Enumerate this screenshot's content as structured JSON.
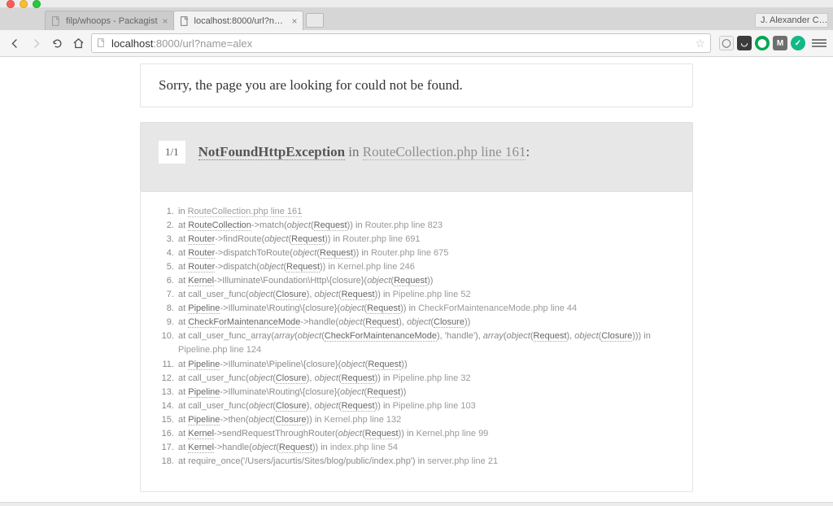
{
  "os": {
    "user_pill": "J. Alexander C…"
  },
  "tabs": [
    {
      "title": "filp/whoops - Packagist",
      "active": false
    },
    {
      "title": "localhost:8000/url?name=…",
      "active": true
    }
  ],
  "address": {
    "host": "localhost",
    "port_path": ":8000/url?name=alex"
  },
  "page": {
    "error_title": "Sorry, the page you are looking for could not be found.",
    "exception": {
      "counter": "1/1",
      "name": "NotFoundHttpException",
      "joiner": " in ",
      "file": "RouteCollection.php line 161",
      "colon": ":"
    },
    "trace": [
      [
        {
          "t": "plain",
          "v": "in "
        },
        {
          "t": "file-u",
          "v": "RouteCollection.php line 161"
        }
      ],
      [
        {
          "t": "at",
          "v": "at "
        },
        {
          "t": "class",
          "v": "RouteCollection"
        },
        {
          "t": "arrow",
          "v": "->"
        },
        {
          "t": "method",
          "v": "match("
        },
        {
          "t": "italic",
          "v": "object"
        },
        {
          "t": "plain",
          "v": "("
        },
        {
          "t": "obj",
          "v": "Request"
        },
        {
          "t": "plain",
          "v": ")) in "
        },
        {
          "t": "file",
          "v": "Router.php line 823"
        }
      ],
      [
        {
          "t": "at",
          "v": "at "
        },
        {
          "t": "class",
          "v": "Router"
        },
        {
          "t": "arrow",
          "v": "->"
        },
        {
          "t": "method",
          "v": "findRoute("
        },
        {
          "t": "italic",
          "v": "object"
        },
        {
          "t": "plain",
          "v": "("
        },
        {
          "t": "obj",
          "v": "Request"
        },
        {
          "t": "plain",
          "v": ")) in "
        },
        {
          "t": "file",
          "v": "Router.php line 691"
        }
      ],
      [
        {
          "t": "at",
          "v": "at "
        },
        {
          "t": "class",
          "v": "Router"
        },
        {
          "t": "arrow",
          "v": "->"
        },
        {
          "t": "method",
          "v": "dispatchToRoute("
        },
        {
          "t": "italic",
          "v": "object"
        },
        {
          "t": "plain",
          "v": "("
        },
        {
          "t": "obj",
          "v": "Request"
        },
        {
          "t": "plain",
          "v": ")) in "
        },
        {
          "t": "file",
          "v": "Router.php line 675"
        }
      ],
      [
        {
          "t": "at",
          "v": "at "
        },
        {
          "t": "class",
          "v": "Router"
        },
        {
          "t": "arrow",
          "v": "->"
        },
        {
          "t": "method",
          "v": "dispatch("
        },
        {
          "t": "italic",
          "v": "object"
        },
        {
          "t": "plain",
          "v": "("
        },
        {
          "t": "obj",
          "v": "Request"
        },
        {
          "t": "plain",
          "v": ")) in "
        },
        {
          "t": "file",
          "v": "Kernel.php line 246"
        }
      ],
      [
        {
          "t": "at",
          "v": "at "
        },
        {
          "t": "class",
          "v": "Kernel"
        },
        {
          "t": "arrow",
          "v": "->"
        },
        {
          "t": "method",
          "v": "Illuminate\\Foundation\\Http\\{closure}("
        },
        {
          "t": "italic",
          "v": "object"
        },
        {
          "t": "plain",
          "v": "("
        },
        {
          "t": "obj",
          "v": "Request"
        },
        {
          "t": "plain",
          "v": "))"
        }
      ],
      [
        {
          "t": "at",
          "v": "at "
        },
        {
          "t": "plain",
          "v": "call_user_func("
        },
        {
          "t": "italic",
          "v": "object"
        },
        {
          "t": "plain",
          "v": "("
        },
        {
          "t": "obj",
          "v": "Closure"
        },
        {
          "t": "plain",
          "v": "), "
        },
        {
          "t": "italic",
          "v": "object"
        },
        {
          "t": "plain",
          "v": "("
        },
        {
          "t": "obj",
          "v": "Request"
        },
        {
          "t": "plain",
          "v": ")) in "
        },
        {
          "t": "file",
          "v": "Pipeline.php line 52"
        }
      ],
      [
        {
          "t": "at",
          "v": "at "
        },
        {
          "t": "class",
          "v": "Pipeline"
        },
        {
          "t": "arrow",
          "v": "->"
        },
        {
          "t": "method",
          "v": "Illuminate\\Routing\\{closure}("
        },
        {
          "t": "italic",
          "v": "object"
        },
        {
          "t": "plain",
          "v": "("
        },
        {
          "t": "obj",
          "v": "Request"
        },
        {
          "t": "plain",
          "v": ")) in "
        },
        {
          "t": "file",
          "v": "CheckForMaintenanceMode.php line 44"
        }
      ],
      [
        {
          "t": "at",
          "v": "at "
        },
        {
          "t": "class",
          "v": "CheckForMaintenanceMode"
        },
        {
          "t": "arrow",
          "v": "->"
        },
        {
          "t": "method",
          "v": "handle("
        },
        {
          "t": "italic",
          "v": "object"
        },
        {
          "t": "plain",
          "v": "("
        },
        {
          "t": "obj",
          "v": "Request"
        },
        {
          "t": "plain",
          "v": "), "
        },
        {
          "t": "italic",
          "v": "object"
        },
        {
          "t": "plain",
          "v": "("
        },
        {
          "t": "obj",
          "v": "Closure"
        },
        {
          "t": "plain",
          "v": "))"
        }
      ],
      [
        {
          "t": "at",
          "v": "at "
        },
        {
          "t": "plain",
          "v": "call_user_func_array("
        },
        {
          "t": "italic",
          "v": "array"
        },
        {
          "t": "plain",
          "v": "("
        },
        {
          "t": "italic",
          "v": "object"
        },
        {
          "t": "plain",
          "v": "("
        },
        {
          "t": "obj",
          "v": "CheckForMaintenanceMode"
        },
        {
          "t": "plain",
          "v": "), 'handle'), "
        },
        {
          "t": "italic",
          "v": "array"
        },
        {
          "t": "plain",
          "v": "("
        },
        {
          "t": "italic",
          "v": "object"
        },
        {
          "t": "plain",
          "v": "("
        },
        {
          "t": "obj",
          "v": "Request"
        },
        {
          "t": "plain",
          "v": "), "
        },
        {
          "t": "italic",
          "v": "object"
        },
        {
          "t": "plain",
          "v": "("
        },
        {
          "t": "obj",
          "v": "Closure"
        },
        {
          "t": "plain",
          "v": "))) in "
        },
        {
          "t": "file",
          "v": "Pipeline.php line 124"
        }
      ],
      [
        {
          "t": "at",
          "v": "at "
        },
        {
          "t": "class",
          "v": "Pipeline"
        },
        {
          "t": "arrow",
          "v": "->"
        },
        {
          "t": "method",
          "v": "Illuminate\\Pipeline\\{closure}("
        },
        {
          "t": "italic",
          "v": "object"
        },
        {
          "t": "plain",
          "v": "("
        },
        {
          "t": "obj",
          "v": "Request"
        },
        {
          "t": "plain",
          "v": "))"
        }
      ],
      [
        {
          "t": "at",
          "v": "at "
        },
        {
          "t": "plain",
          "v": "call_user_func("
        },
        {
          "t": "italic",
          "v": "object"
        },
        {
          "t": "plain",
          "v": "("
        },
        {
          "t": "obj",
          "v": "Closure"
        },
        {
          "t": "plain",
          "v": "), "
        },
        {
          "t": "italic",
          "v": "object"
        },
        {
          "t": "plain",
          "v": "("
        },
        {
          "t": "obj",
          "v": "Request"
        },
        {
          "t": "plain",
          "v": ")) in "
        },
        {
          "t": "file",
          "v": "Pipeline.php line 32"
        }
      ],
      [
        {
          "t": "at",
          "v": "at "
        },
        {
          "t": "class",
          "v": "Pipeline"
        },
        {
          "t": "arrow",
          "v": "->"
        },
        {
          "t": "method",
          "v": "Illuminate\\Routing\\{closure}("
        },
        {
          "t": "italic",
          "v": "object"
        },
        {
          "t": "plain",
          "v": "("
        },
        {
          "t": "obj",
          "v": "Request"
        },
        {
          "t": "plain",
          "v": "))"
        }
      ],
      [
        {
          "t": "at",
          "v": "at "
        },
        {
          "t": "plain",
          "v": "call_user_func("
        },
        {
          "t": "italic",
          "v": "object"
        },
        {
          "t": "plain",
          "v": "("
        },
        {
          "t": "obj",
          "v": "Closure"
        },
        {
          "t": "plain",
          "v": "), "
        },
        {
          "t": "italic",
          "v": "object"
        },
        {
          "t": "plain",
          "v": "("
        },
        {
          "t": "obj",
          "v": "Request"
        },
        {
          "t": "plain",
          "v": ")) in "
        },
        {
          "t": "file",
          "v": "Pipeline.php line 103"
        }
      ],
      [
        {
          "t": "at",
          "v": "at "
        },
        {
          "t": "class",
          "v": "Pipeline"
        },
        {
          "t": "arrow",
          "v": "->"
        },
        {
          "t": "method",
          "v": "then("
        },
        {
          "t": "italic",
          "v": "object"
        },
        {
          "t": "plain",
          "v": "("
        },
        {
          "t": "obj",
          "v": "Closure"
        },
        {
          "t": "plain",
          "v": ")) in "
        },
        {
          "t": "file",
          "v": "Kernel.php line 132"
        }
      ],
      [
        {
          "t": "at",
          "v": "at "
        },
        {
          "t": "class",
          "v": "Kernel"
        },
        {
          "t": "arrow",
          "v": "->"
        },
        {
          "t": "method",
          "v": "sendRequestThroughRouter("
        },
        {
          "t": "italic",
          "v": "object"
        },
        {
          "t": "plain",
          "v": "("
        },
        {
          "t": "obj",
          "v": "Request"
        },
        {
          "t": "plain",
          "v": ")) in "
        },
        {
          "t": "file",
          "v": "Kernel.php line 99"
        }
      ],
      [
        {
          "t": "at",
          "v": "at "
        },
        {
          "t": "class",
          "v": "Kernel"
        },
        {
          "t": "arrow",
          "v": "->"
        },
        {
          "t": "method",
          "v": "handle("
        },
        {
          "t": "italic",
          "v": "object"
        },
        {
          "t": "plain",
          "v": "("
        },
        {
          "t": "obj",
          "v": "Request"
        },
        {
          "t": "plain",
          "v": ")) in "
        },
        {
          "t": "file",
          "v": "index.php line 54"
        }
      ],
      [
        {
          "t": "at",
          "v": "at "
        },
        {
          "t": "plain",
          "v": "require_once('/Users/jacurtis/Sites/blog/public/index.php') in "
        },
        {
          "t": "file",
          "v": "server.php line 21"
        }
      ]
    ]
  }
}
